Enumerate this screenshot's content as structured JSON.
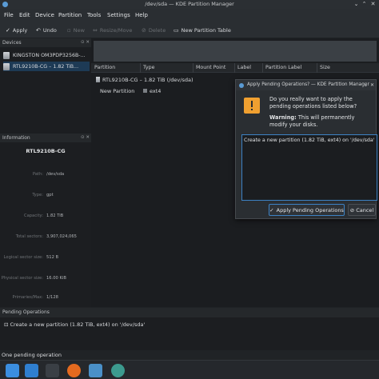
{
  "window": {
    "title": "/dev/sda — KDE Partition Manager"
  },
  "menu": [
    "File",
    "Edit",
    "Device",
    "Partition",
    "Tools",
    "Settings",
    "Help"
  ],
  "toolbar": {
    "apply": "Apply",
    "undo": "Undo",
    "new": "New",
    "resize": "Resize/Move",
    "delete": "Delete",
    "new_table": "New Partition Table"
  },
  "devices": {
    "header": "Devices",
    "items": [
      "KINGSTON OM3PDP3256B-...",
      "RTL9210B-CG – 1.82 TiB..."
    ]
  },
  "information": {
    "header": "Information",
    "device_name": "RTL9210B-CG",
    "rows": [
      {
        "label": "Path:",
        "value": "/dev/sda"
      },
      {
        "label": "Type:",
        "value": "gpt"
      },
      {
        "label": "Capacity:",
        "value": "1.82 TiB"
      },
      {
        "label": "Total sectors:",
        "value": "3,907,024,065"
      },
      {
        "label": "Logical sector size:",
        "value": "512 B"
      },
      {
        "label": "Physical sector size:",
        "value": "16.00 KiB"
      },
      {
        "label": "Primaries/Max:",
        "value": "1/128"
      }
    ]
  },
  "table": {
    "columns": [
      "Partition",
      "Type",
      "Mount Point",
      "Label",
      "Partition Label",
      "Size"
    ],
    "device_row": "RTL9210B-CG – 1.82 TiB (/dev/sda)",
    "partition_row": {
      "partition": "New Partition",
      "type": "ext4"
    }
  },
  "pending": {
    "header": "Pending Operations",
    "operation": "Create a new partition (1.82 TiB, ext4) on '/dev/sda'"
  },
  "status": {
    "text": "One pending operation"
  },
  "dialog": {
    "title": "Apply Pending Operations? — KDE Partition Manager",
    "question": "Do you really want to apply the pending operations listed below?",
    "warning_bold": "Warning:",
    "warning_text": "This will permanently modify your disks.",
    "list_item": "Create a new partition (1.82 TiB, ext4) on '/dev/sda'",
    "apply_button": "Apply Pending Operations",
    "cancel_button": "Cancel"
  },
  "colors": {
    "accent": "#3d82c4",
    "warning": "#f0a030",
    "background": "#1b1d20"
  },
  "taskbar_icons": [
    "app-launcher-icon",
    "discover-icon",
    "system-settings-icon",
    "firefox-icon",
    "file-manager-icon",
    "partition-manager-icon"
  ]
}
